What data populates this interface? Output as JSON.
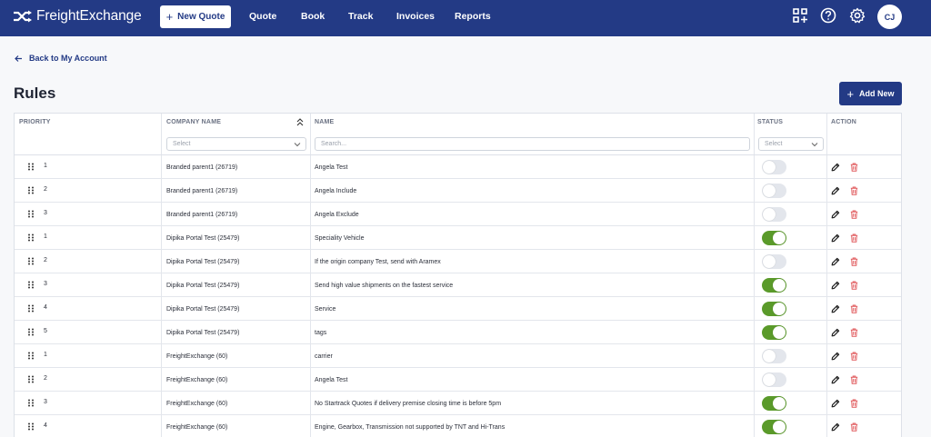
{
  "brand": {
    "name": "FreightExchange"
  },
  "nav": {
    "new_quote_label": "New Quote",
    "links": [
      "Quote",
      "Book",
      "Track",
      "Invoices",
      "Reports"
    ],
    "icons": [
      "add-grid-icon",
      "help-icon",
      "gear-icon"
    ],
    "avatar_initials": "CJ"
  },
  "page": {
    "back_label": "Back to My Account",
    "title": "Rules",
    "add_new_label": "Add New"
  },
  "table": {
    "headers": {
      "priority": "PRIORITY",
      "company": "COMPANY NAME",
      "name": "NAME",
      "status": "STATUS",
      "action": "ACTION"
    },
    "filters": {
      "company_placeholder": "Select",
      "name_placeholder": "Search...",
      "status_placeholder": "Select"
    },
    "rows": [
      {
        "priority": "1",
        "company": "Branded parent1 (26719)",
        "name": "Angela Test",
        "enabled": false
      },
      {
        "priority": "2",
        "company": "Branded parent1 (26719)",
        "name": "Angela Include",
        "enabled": false
      },
      {
        "priority": "3",
        "company": "Branded parent1 (26719)",
        "name": "Angela Exclude",
        "enabled": false
      },
      {
        "priority": "1",
        "company": "Dipika Portal Test (25479)",
        "name": "Speciality Vehicle",
        "enabled": true
      },
      {
        "priority": "2",
        "company": "Dipika Portal Test (25479)",
        "name": "If the origin company Test, send with Aramex",
        "enabled": false
      },
      {
        "priority": "3",
        "company": "Dipika Portal Test (25479)",
        "name": "Send high value shipments on the fastest service",
        "enabled": true
      },
      {
        "priority": "4",
        "company": "Dipika Portal Test (25479)",
        "name": "Service",
        "enabled": true
      },
      {
        "priority": "5",
        "company": "Dipika Portal Test (25479)",
        "name": "tags",
        "enabled": true
      },
      {
        "priority": "1",
        "company": "FreightExchange (60)",
        "name": "carrier",
        "enabled": false
      },
      {
        "priority": "2",
        "company": "FreightExchange (60)",
        "name": "Angela Test",
        "enabled": false
      },
      {
        "priority": "3",
        "company": "FreightExchange (60)",
        "name": "No Startrack Quotes if delivery premise closing time is before 5pm",
        "enabled": true
      },
      {
        "priority": "4",
        "company": "FreightExchange (60)",
        "name": "Engine, Gearbox, Transmission not supported by TNT and Hi-Trans",
        "enabled": true
      }
    ]
  },
  "colors": {
    "primary": "#233a85",
    "toggle_on": "#5a9a2a",
    "toggle_off": "#e3e6ec",
    "delete": "#e0585b"
  }
}
